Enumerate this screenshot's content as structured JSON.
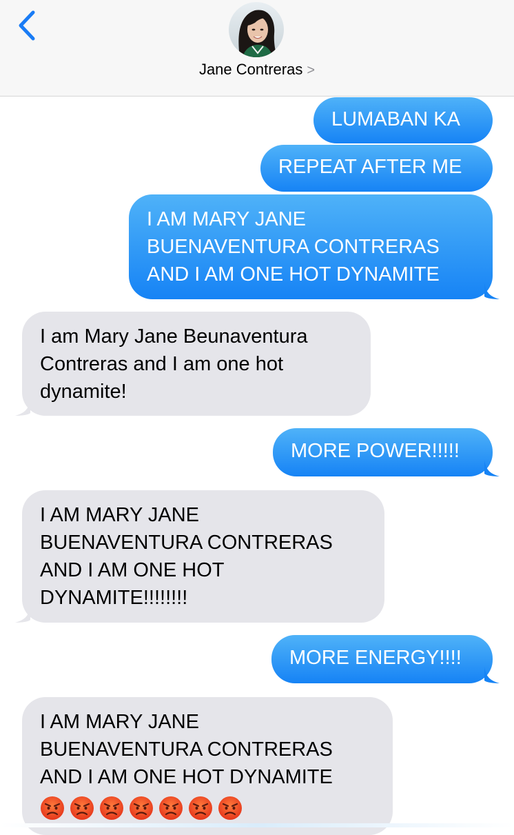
{
  "header": {
    "contact_name": "Jane Contreras",
    "back_icon": "chevron-left-icon",
    "detail_icon": "chevron-right-icon",
    "chevron_glyph": ">"
  },
  "colors": {
    "sent_bubble": "#1a8cf9",
    "received_bubble": "#e5e5ea",
    "accent": "#1a7cf5",
    "header_bg": "#f7f7f7"
  },
  "messages": [
    {
      "direction": "sent",
      "lines": [
        "LUMABAN KA"
      ]
    },
    {
      "direction": "sent",
      "lines": [
        "REPEAT AFTER ME"
      ]
    },
    {
      "direction": "sent",
      "lines": [
        "I AM MARY JANE",
        "BUENAVENTURA CONTRERAS",
        "AND I AM ONE HOT DYNAMITE"
      ]
    },
    {
      "direction": "received",
      "lines": [
        "I am Mary Jane Beunaventura",
        "Contreras and I am one hot",
        "dynamite!"
      ]
    },
    {
      "direction": "sent",
      "lines": [
        "MORE POWER!!!!!"
      ]
    },
    {
      "direction": "received",
      "lines": [
        "I AM MARY JANE",
        "BUENAVENTURA CONTRERAS",
        "AND I AM ONE HOT",
        "DYNAMITE!!!!!!!!"
      ]
    },
    {
      "direction": "sent",
      "lines": [
        "MORE ENERGY!!!!"
      ]
    },
    {
      "direction": "received",
      "lines": [
        "I AM MARY JANE",
        "BUENAVENTURA CONTRERAS",
        "AND I AM ONE HOT DYNAMITE"
      ],
      "emoji": "angry-face-icon",
      "emoji_count": 7
    }
  ]
}
